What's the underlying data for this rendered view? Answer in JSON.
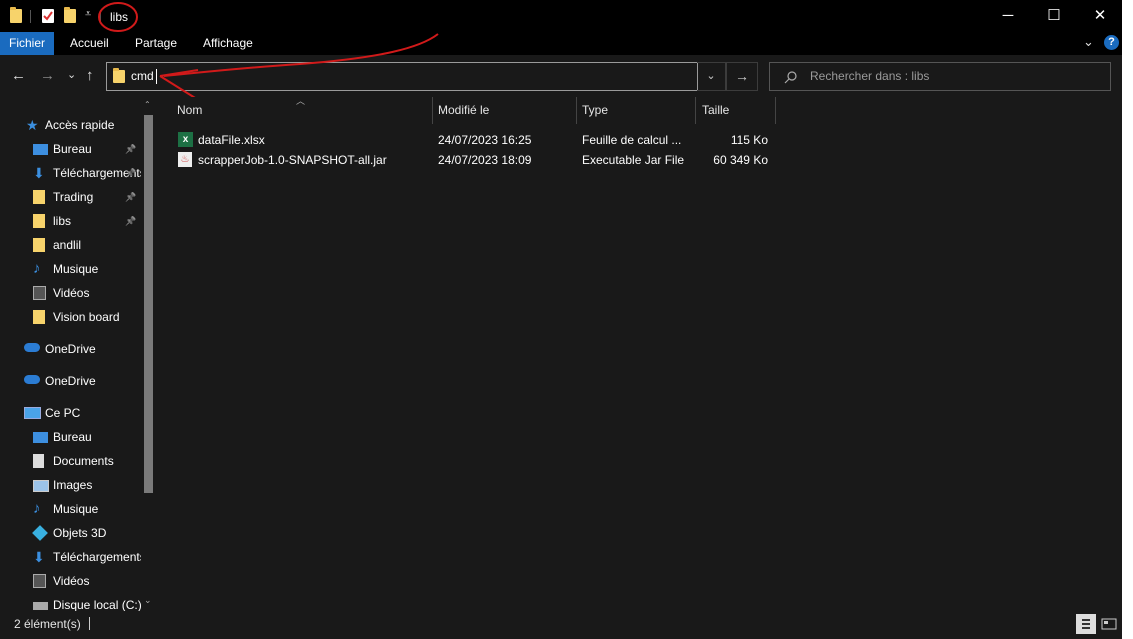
{
  "window": {
    "title": "libs",
    "minimize": "─",
    "maximize": "☐",
    "close": "✕"
  },
  "ribbon": {
    "tabs": [
      "Fichier",
      "Accueil",
      "Partage",
      "Affichage"
    ],
    "expand": "⌄",
    "help": "?"
  },
  "nav": {
    "back": "←",
    "forward": "→",
    "recent": "⌄",
    "up": "↑",
    "address_value": "cmd",
    "dropdown": "⌄",
    "go": "→",
    "search_placeholder": "Rechercher dans : libs"
  },
  "sidebar": {
    "quick_access": "Accès rapide",
    "items_quick": [
      {
        "label": "Bureau",
        "icon": "desktop-icon",
        "pinned": true
      },
      {
        "label": "Téléchargements",
        "icon": "download-icon",
        "pinned": true
      },
      {
        "label": "Trading",
        "icon": "folder-icon",
        "pinned": true
      },
      {
        "label": "libs",
        "icon": "folder-icon",
        "pinned": true
      },
      {
        "label": "andlil",
        "icon": "folder-icon",
        "pinned": false
      },
      {
        "label": "Musique",
        "icon": "music-icon",
        "pinned": false
      },
      {
        "label": "Vidéos",
        "icon": "video-icon",
        "pinned": false
      },
      {
        "label": "Vision board",
        "icon": "folder-icon",
        "pinned": false
      }
    ],
    "onedrive_1": "OneDrive",
    "onedrive_2": "OneDrive",
    "this_pc": "Ce PC",
    "items_pc": [
      {
        "label": "Bureau",
        "icon": "desktop-icon"
      },
      {
        "label": "Documents",
        "icon": "documents-icon"
      },
      {
        "label": "Images",
        "icon": "images-icon"
      },
      {
        "label": "Musique",
        "icon": "music-icon"
      },
      {
        "label": "Objets 3D",
        "icon": "objects3d-icon"
      },
      {
        "label": "Téléchargements",
        "icon": "download-icon"
      },
      {
        "label": "Vidéos",
        "icon": "video-icon"
      },
      {
        "label": "Disque local (C:)",
        "icon": "drive-icon"
      }
    ]
  },
  "columns": [
    "Nom",
    "Modifié le",
    "Type",
    "Taille"
  ],
  "files": [
    {
      "name": "dataFile.xlsx",
      "modified": "24/07/2023 16:25",
      "type": "Feuille de calcul ...",
      "size": "115 Ko",
      "icon": "excel-icon"
    },
    {
      "name": "scrapperJob-1.0-SNAPSHOT-all.jar",
      "modified": "24/07/2023 18:09",
      "type": "Executable Jar File",
      "size": "60 349 Ko",
      "icon": "java-icon"
    }
  ],
  "status": {
    "count": "2 élément(s)"
  },
  "colors": {
    "accent": "#1a6bbf",
    "annotation": "#d11a1a"
  }
}
